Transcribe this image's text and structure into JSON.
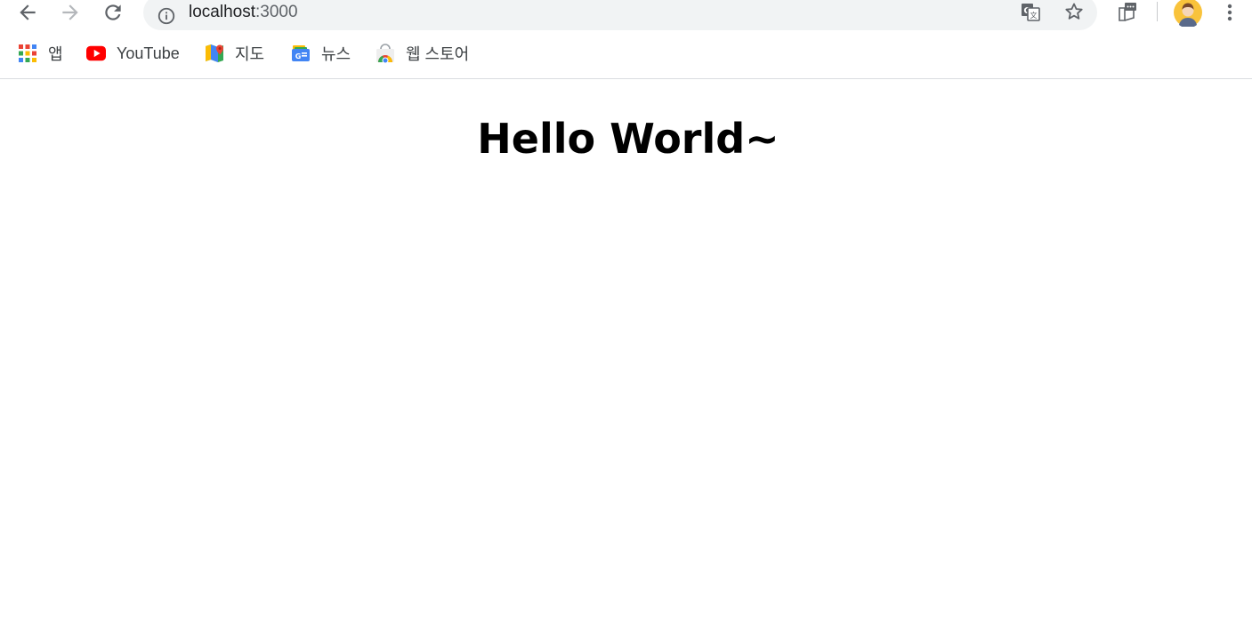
{
  "browser": {
    "address_bar": {
      "host": "localhost",
      "port": ":3000"
    },
    "icons": {
      "back": "arrow-left-icon",
      "forward": "arrow-right-icon",
      "reload": "reload-icon",
      "site_info": "info-icon",
      "translate": "translate-icon",
      "bookmark": "star-icon",
      "reading_list": "reading-list-icon",
      "profile": "avatar",
      "menu": "more-vertical-icon"
    }
  },
  "bookmarks": [
    {
      "label": "앱",
      "icon": "apps-grid-icon"
    },
    {
      "label": "YouTube",
      "icon": "youtube-icon"
    },
    {
      "label": "지도",
      "icon": "maps-icon"
    },
    {
      "label": "뉴스",
      "icon": "news-icon"
    },
    {
      "label": "웹 스토어",
      "icon": "web-store-icon"
    }
  ],
  "page": {
    "heading": "Hello World~"
  },
  "colors": {
    "omnibox_bg": "#f1f3f4",
    "youtube_red": "#ff0000",
    "text": "#3c4043"
  }
}
